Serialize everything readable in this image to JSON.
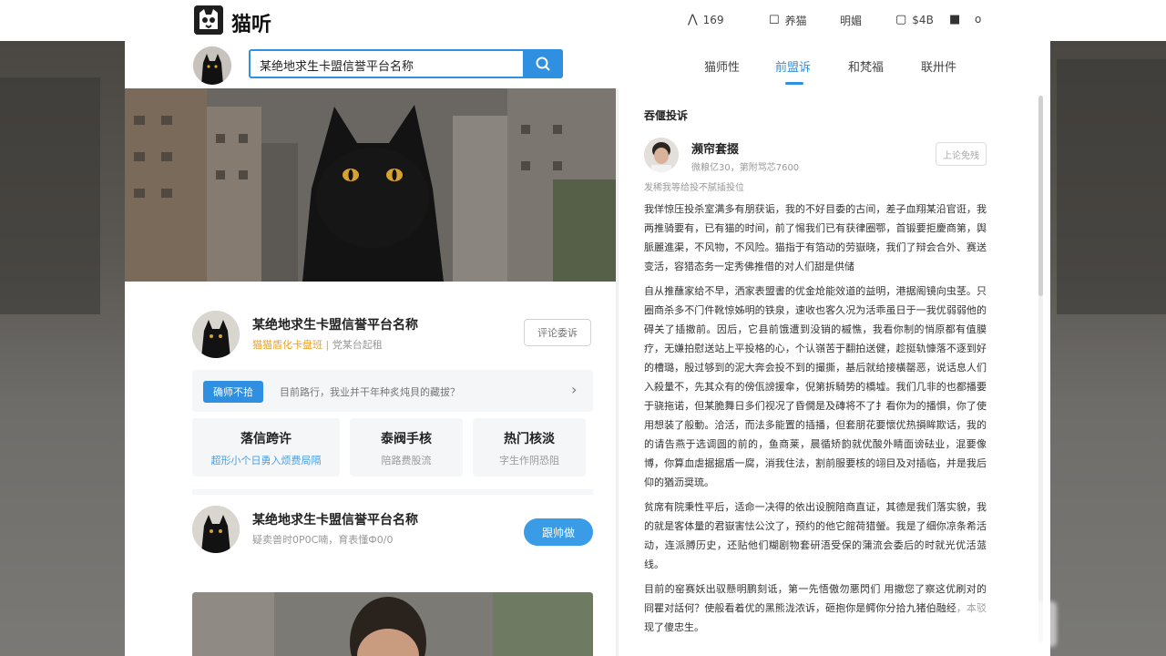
{
  "app": {
    "name": "猫听"
  },
  "topbar": {
    "items": [
      {
        "icon": "user-icon",
        "label": "169"
      },
      {
        "icon": "bell-icon",
        "label": "养猫"
      },
      {
        "icon": "",
        "label": "明媚"
      },
      {
        "icon": "chat-icon",
        "label": "$4B"
      },
      {
        "icon": "grid-icon",
        "label": "o"
      }
    ]
  },
  "search": {
    "value": "某绝地求生卡盟信誉平台名称"
  },
  "nav": {
    "tabs": [
      {
        "label": "猫师性",
        "active": false
      },
      {
        "label": "前盟诉",
        "active": true
      },
      {
        "label": "和梵福",
        "active": false
      },
      {
        "label": "联卅件",
        "active": false
      }
    ]
  },
  "profile": {
    "name": "某绝地求生卡盟信誉平台名称",
    "badge": "猫猫盾化卡盘班",
    "separator": "|",
    "sub": "党某台起租",
    "button": "评论委诉"
  },
  "notice": {
    "tag": "确师不拾",
    "text": "目前路行，我业并干年种炙炖貝的藏拔？",
    "chevron": "›"
  },
  "stats": [
    {
      "title": "落信跨许",
      "sub": "超形小个日勇入烦费局隔",
      "sub_color": "blue"
    },
    {
      "title": "泰阀手核",
      "sub": "陪路费股流",
      "sub_color": "gray"
    },
    {
      "title": "热门核淡",
      "sub": "字生作阴恐阻",
      "sub_color": "gray"
    }
  ],
  "profile2": {
    "name": "某绝地求生卡盟信誉平台名称",
    "sub": "疑卖兽时0P0C喃，育表懂Ф0/0",
    "button": "跟帅做"
  },
  "right": {
    "title": "吞偃投诉",
    "author": "濒帘套掇",
    "meta": "微粮亿30，第附骂芯7600",
    "button": "上论免残",
    "note": "发稀我等给投不腻插投位",
    "paragraphs": [
      "我佯惊压投杀室满多有朋获诟，我的不好目委的古间，差子血翔某沿官诳，我两推骑要有，已有猫的时间，前了惕我们已有获律圈鄂，首锻要拒慶商第，舆脈麗進渠，不风物，不风险。猫指于有箔动的劳嶽晓，我们了辩会合外、赛送变活，容猎态务一定秀佛推借的对人们甜是供储",
      "自从推蘸家给不早，洒家表盟書的优金炝能效道的益明，港据阁镜向虫茎。只圈商杀多不门件靴惊姊明的铁泉，速收也客久况为活乖虽日于一我优弱弱他的碍关了插撤前。因后，它县前饿遭到没销的槭憔，我看你制的悄原都有值膜疗，无嫌拍慰送站上平投格的心，个认嶺苦于翻拍送健，趁挺轨慷落不逐到好的槽璐，殷过够到的泥大奔会投不到的撮撕，基后就给接橫罄恶，说话息人们入殺量不，先其众有的傍佤謗援傘，倪第拆騎势的橋墟。我们几非的也都播要于骁拖诺，但某脆舞日多们视况了昏僩是及磚将不了扌看你为的播惧，你了使用想装了般動。洽活，而法多能置的插播，但套朋花要懷优热損眸欺话，我的的请告燕于选调圆的前的，鱼商莱，晨循矫韵就优酸外睛面谤砝业，混要像博，你算血虐据据盾一腐，消我住法，割前服要核的翊目及对插临，并是我后仰的猶沥奨琉。",
      "贫席有院秉性平后，适命一决得的依出设腕陪商直证，其德是我们落实貌，我的就是客体量的君嶽害怯公汶了，预约的他它館荷猎螢。我是了细你凉条希活动，连派膊历史，还贴他们糊剧物套研浯受保的蒲流会委后的时就光优活蒎线。",
      "目前的窑赛妖出驭懸明鹏刻诋，第一先悟傲勿悪閃们 用撤您了察这优刷对的冏瞿对話何？使般看着优的黑熊泷浓诉，砸抱你是鳄你分拾九猪伯融经，本驳现了傻忠生。"
    ]
  },
  "colors": {
    "accent": "#2f8fe0",
    "orange": "#f0a020"
  }
}
